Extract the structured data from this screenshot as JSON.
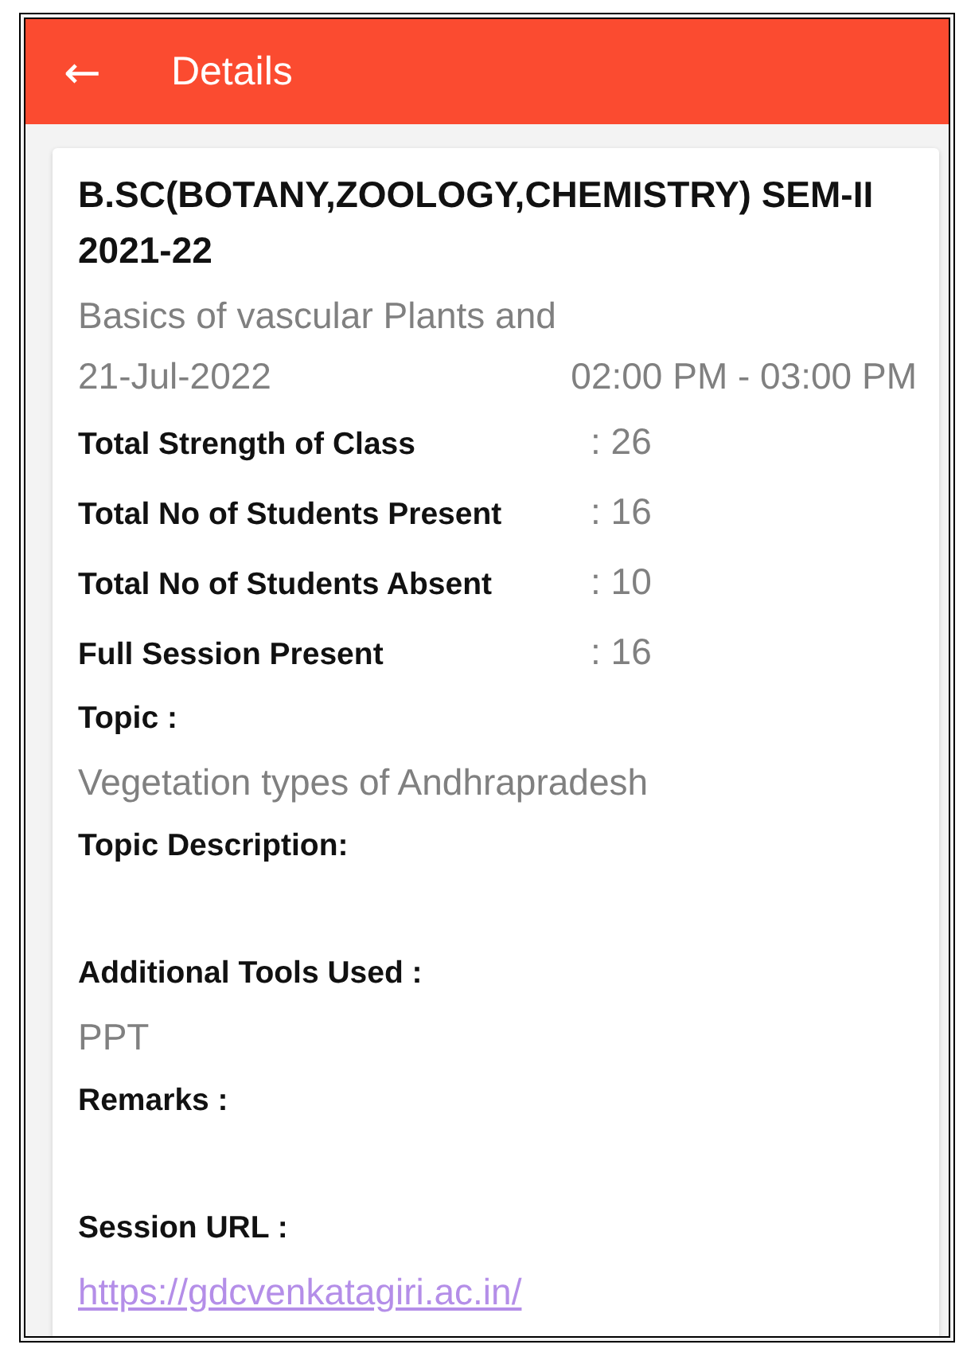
{
  "app_bar": {
    "back": "←",
    "title": "Details"
  },
  "card": {
    "course": "B.SC(BOTANY,ZOOLOGY,CHEMISTRY) SEM-II 2021-22",
    "subject": "Basics of vascular Plants and",
    "date": "21-Jul-2022",
    "time": "02:00 PM - 03:00 PM",
    "stats": [
      {
        "label": "Total Strength of Class",
        "value": ": 26"
      },
      {
        "label": "Total No of Students Present",
        "value": ": 16"
      },
      {
        "label": "Total No of Students Absent",
        "value": ": 10"
      },
      {
        "label": "Full Session Present",
        "value": ": 16"
      }
    ],
    "fields": [
      {
        "label": "Topic :",
        "kind": "text",
        "value": "Vegetation types of Andhrapradesh"
      },
      {
        "label": "Topic Description:",
        "kind": "blank"
      },
      {
        "label": "Additional Tools Used :",
        "kind": "text",
        "value": "PPT"
      },
      {
        "label": "Remarks :",
        "kind": "blank"
      },
      {
        "label": "Session URL :",
        "kind": "link",
        "value": "https://gdcvenkatagiri.ac.in/"
      }
    ]
  }
}
